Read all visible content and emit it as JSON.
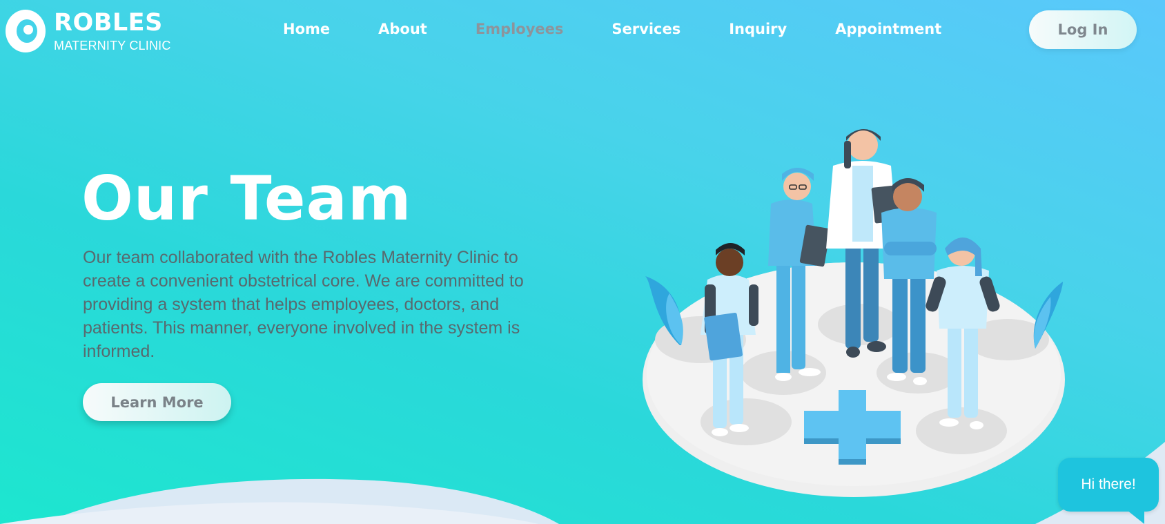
{
  "brand": {
    "title": "ROBLES",
    "subtitle": "MATERNITY CLINIC",
    "icon": "mother-baby-icon"
  },
  "nav": {
    "items": [
      {
        "label": "Home"
      },
      {
        "label": "About"
      },
      {
        "label": "Employees",
        "active": true
      },
      {
        "label": "Services"
      },
      {
        "label": "Inquiry"
      },
      {
        "label": "Appointment"
      }
    ],
    "active_color": "#8d949b"
  },
  "login": {
    "label": "Log In"
  },
  "hero": {
    "title": "Our Team",
    "description": "Our team collaborated with the Robles Maternity Clinic to create a convenient obstetrical core. We are committed to providing a system that helps employees, doctors, and patients. This manner, everyone involved in the system is informed.",
    "cta": "Learn More"
  },
  "illustration": {
    "icon": "medical-team-illustration"
  },
  "chat": {
    "label": "Hi there!",
    "icon": "chat-bubble-icon"
  },
  "colors": {
    "gradient_start": "#1de6cf",
    "gradient_end": "#5ac8fb",
    "scrub_blue": "#4fb3e4",
    "accent_cyan": "#1ec4de"
  }
}
